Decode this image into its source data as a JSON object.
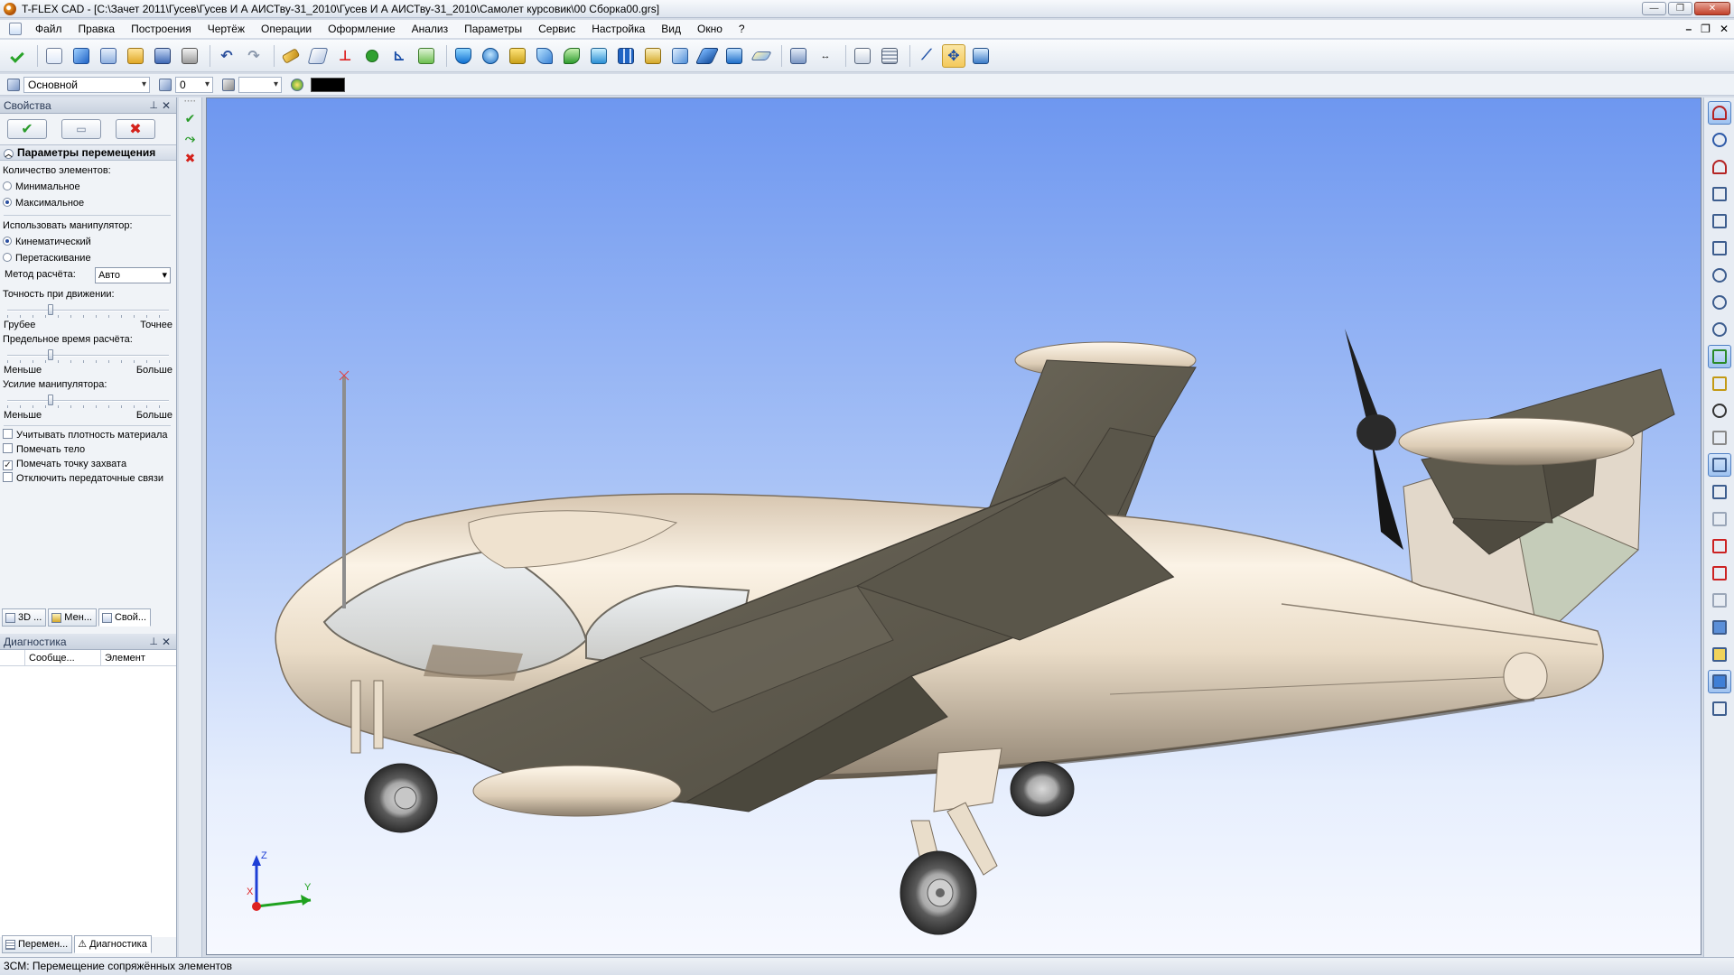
{
  "window": {
    "title": "T-FLEX CAD - [C:\\Зачет 2011\\Гусев\\Гусев И А АИСТву-31_2010\\Гусев И А АИСТву-31_2010\\Самолет курсовик\\00 Сборка00.grs]",
    "minimize": "—",
    "restore": "❐",
    "close": "✕"
  },
  "menu": {
    "items": [
      "Файл",
      "Правка",
      "Построения",
      "Чертёж",
      "Операции",
      "Оформление",
      "Анализ",
      "Параметры",
      "Сервис",
      "Настройка",
      "Вид",
      "Окно",
      "?"
    ],
    "mdi_min": "–",
    "mdi_restore": "❐",
    "mdi_close": "✕"
  },
  "toolbar2": {
    "layer_name": "Основной",
    "level_value": "0"
  },
  "properties_panel": {
    "header": "Свойства",
    "pin": "⊥",
    "close": "✕",
    "section_title": "Параметры перемещения",
    "count_label": "Количество элементов:",
    "count_min": "Минимальное",
    "count_max": "Максимальное",
    "manipulator_label": "Использовать манипулятор:",
    "manip_kinematic": "Кинематический",
    "manip_drag": "Перетаскивание",
    "method_label": "Метод расчёта:",
    "method_value": "Авто",
    "precision_label": "Точность при движении:",
    "precision_min": "Грубее",
    "precision_max": "Точнее",
    "precision_level": 0.25,
    "time_label": "Предельное время расчёта:",
    "time_min": "Меньше",
    "time_max": "Больше",
    "time_level": 0.25,
    "force_label": "Усилие манипулятора:",
    "force_min": "Меньше",
    "force_max": "Больше",
    "force_level": 0.25,
    "opt_density": "Учитывать плотность материала",
    "opt_mark_body": "Помечать тело",
    "opt_mark_point": "Помечать точку захвата",
    "opt_disable_links": "Отключить передаточные связи",
    "tabs": [
      "3D ...",
      "Мен...",
      "Свой..."
    ]
  },
  "diagnostics_panel": {
    "header": "Диагностика",
    "col_message": "Сообще...",
    "col_element": "Элемент",
    "tabs": [
      "Перемен...",
      "Диагностика"
    ]
  },
  "axes": {
    "x": "X",
    "y": "Y",
    "z": "Z"
  },
  "status": {
    "text": "3СМ: Перемещение сопряжённых элементов"
  }
}
